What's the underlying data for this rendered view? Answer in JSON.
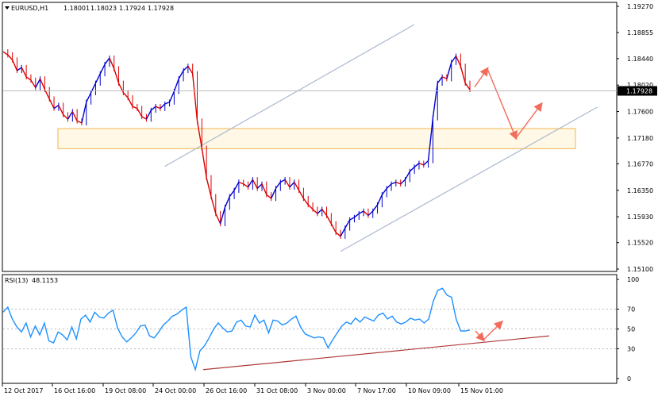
{
  "header": {
    "symbol": "EURUSD,H1",
    "open": "1.18001",
    "high": "1.18023",
    "low": "1.17924",
    "close": "1.17928"
  },
  "rsi_header": {
    "label": "RSI(13)",
    "value": "48.1153"
  },
  "colors": {
    "up_candle": "#0000cc",
    "down_candle": "#dd0000",
    "rsi_line": "#1e90ff",
    "channel": "#aab8cc",
    "zone_border": "#f3c26a",
    "zone_fill": "#fff8e6",
    "arrows": "#f26b5b",
    "rsi_trend": "#b03a3a",
    "current_price_tag": "#000000"
  },
  "chart_data": [
    {
      "type": "line",
      "title": "EURUSD,H1",
      "ylabel": "",
      "ylim": [
        1.151,
        1.1927
      ],
      "y_ticks": [
        "1.19270",
        "1.18855",
        "1.18440",
        "1.18020",
        "1.17600",
        "1.17180",
        "1.16770",
        "1.16350",
        "1.15930",
        "1.15520",
        "1.15100"
      ],
      "current_price": "1.17928",
      "x_labels": [
        "12 Oct 2017",
        "16 Oct 16:00",
        "19 Oct 08:00",
        "24 Oct 00:00",
        "26 Oct 16:00",
        "31 Oct 08:00",
        "3 Nov 00:00",
        "7 Nov 17:00",
        "10 Nov 09:00",
        "15 Nov 01:00"
      ],
      "series": [
        {
          "values": [
            1.1855,
            1.185,
            1.1842,
            1.1825,
            1.183,
            1.1815,
            1.181,
            1.1798,
            1.1812,
            1.1795,
            1.178,
            1.1765,
            1.177,
            1.1755,
            1.1748,
            1.176,
            1.1745,
            1.1742,
            1.1775,
            1.179,
            1.1805,
            1.182,
            1.1835,
            1.1845,
            1.1828,
            1.1805,
            1.179,
            1.1782,
            1.1768,
            1.1765,
            1.1752,
            1.1748,
            1.1762,
            1.1768,
            1.1765,
            1.1772,
            1.1775,
            1.1792,
            1.1812,
            1.1825,
            1.1832,
            1.182,
            1.1745,
            1.1702,
            1.1655,
            1.1625,
            1.1598,
            1.1582,
            1.1608,
            1.1625,
            1.1635,
            1.1648,
            1.1645,
            1.164,
            1.1652,
            1.1638,
            1.1645,
            1.1628,
            1.1622,
            1.1638,
            1.1648,
            1.1652,
            1.164,
            1.1648,
            1.1635,
            1.1622,
            1.1612,
            1.1605,
            1.1598,
            1.1605,
            1.1595,
            1.1582,
            1.1568,
            1.1562,
            1.1575,
            1.1588,
            1.1592,
            1.1598,
            1.1602,
            1.1595,
            1.1602,
            1.1612,
            1.1628,
            1.1638,
            1.1645,
            1.1648,
            1.1645,
            1.1652,
            1.1665,
            1.1672,
            1.1678,
            1.1675,
            1.1682,
            1.175,
            1.1805,
            1.1815,
            1.1812,
            1.1838,
            1.1848,
            1.1832,
            1.1805,
            1.1795
          ]
        }
      ],
      "annotations": {
        "channel_upper": [
          [
            0.2505,
            1.1673
          ],
          [
            0.6295,
            1.1898
          ]
        ],
        "channel_lower": [
          [
            0.5175,
            1.1538
          ],
          [
            0.9078,
            1.1767
          ]
        ],
        "zone": [
          1.1701,
          1.1733
        ],
        "arrows": [
          [
            1.1799,
            1.1828
          ],
          [
            1.1828,
            1.1718
          ],
          [
            1.1718,
            1.1772
          ]
        ]
      }
    },
    {
      "type": "line",
      "title": "RSI(13) 48.1153",
      "ylim": [
        0,
        100
      ],
      "y_ticks": [
        "100",
        "70",
        "50",
        "30",
        "0"
      ],
      "levels": [
        70,
        50,
        30
      ],
      "series": [
        {
          "values": [
            67,
            72,
            60,
            52,
            47,
            56,
            42,
            53,
            44,
            56,
            38,
            36,
            47,
            44,
            39,
            52,
            40,
            60,
            64,
            57,
            67,
            62,
            61,
            66,
            69,
            51,
            42,
            37,
            41,
            46,
            53,
            54,
            43,
            41,
            47,
            54,
            58,
            63,
            65,
            69,
            72,
            22,
            9,
            28,
            33,
            41,
            50,
            56,
            51,
            47,
            48,
            57,
            59,
            53,
            52,
            64,
            56,
            59,
            46,
            59,
            58,
            54,
            56,
            60,
            63,
            52,
            45,
            43,
            41,
            42,
            41,
            31,
            39,
            46,
            53,
            57,
            55,
            61,
            57,
            62,
            60,
            58,
            64,
            66,
            60,
            63,
            57,
            55,
            57,
            61,
            59,
            60,
            56,
            60,
            78,
            89,
            91,
            84,
            82,
            60,
            48,
            48,
            49
          ]
        }
      ],
      "annotations": {
        "rsi_trendline": [
          [
            4,
            9
          ],
          [
            93,
            43
          ]
        ],
        "arrows": [
          [
            48,
            39
          ],
          [
            39,
            57
          ]
        ]
      }
    }
  ]
}
